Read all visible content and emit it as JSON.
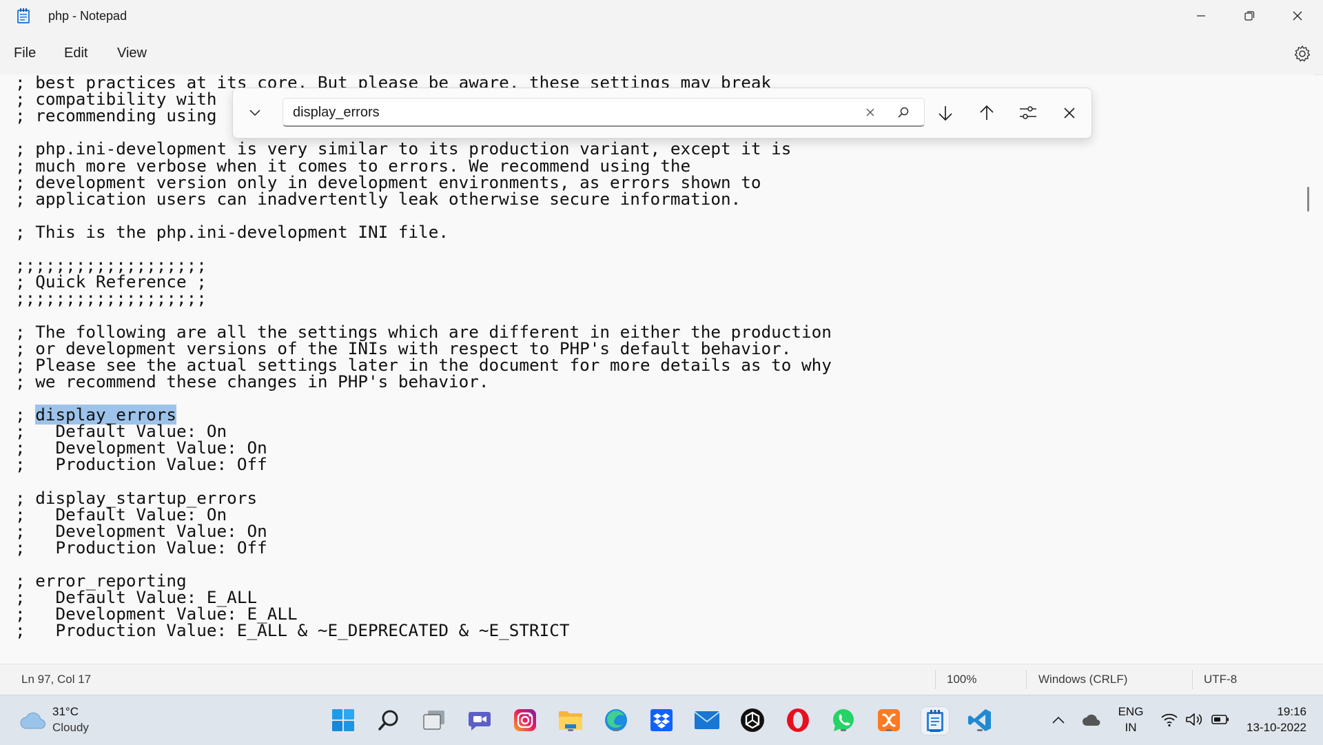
{
  "window": {
    "title": "php - Notepad"
  },
  "menu": {
    "file": "File",
    "edit": "Edit",
    "view": "View"
  },
  "editor": {
    "lines": [
      "; best practices at its core. But please be aware, these settings may break",
      "; compatibility with",
      "; recommending using",
      "",
      "; php.ini-development is very similar to its production variant, except it is",
      "; much more verbose when it comes to errors. We recommend using the",
      "; development version only in development environments, as errors shown to",
      "; application users can inadvertently leak otherwise secure information.",
      "",
      "; This is the php.ini-development INI file.",
      "",
      ";;;;;;;;;;;;;;;;;;;",
      "; Quick Reference ;",
      ";;;;;;;;;;;;;;;;;;;",
      "",
      "; The following are all the settings which are different in either the production",
      "; or development versions of the INIs with respect to PHP's default behavior.",
      "; Please see the actual settings later in the document for more details as to why",
      "; we recommend these changes in PHP's behavior.",
      "",
      "; display_errors",
      ";   Default Value: On",
      ";   Development Value: On",
      ";   Production Value: Off",
      "",
      "; display_startup_errors",
      ";   Default Value: On",
      ";   Development Value: On",
      ";   Production Value: Off",
      "",
      "; error_reporting",
      ";   Default Value: E_ALL",
      ";   Development Value: E_ALL",
      ";   Production Value: E_ALL & ~E_DEPRECATED & ~E_STRICT"
    ],
    "highlight": {
      "prefix": "; ",
      "match": "display_errors"
    }
  },
  "find": {
    "query": "display_errors"
  },
  "status": {
    "position": "Ln 97, Col 17",
    "zoom": "100%",
    "line_ending": "Windows (CRLF)",
    "encoding": "UTF-8"
  },
  "taskbar": {
    "weather_temp": "31°C",
    "weather_desc": "Cloudy",
    "lang_top": "ENG",
    "lang_bottom": "IN",
    "time": "19:16",
    "date": "13-10-2022",
    "apps": [
      "start-icon",
      "search-icon",
      "task-view-icon",
      "teams-chat-icon",
      "instagram-icon",
      "file-explorer-icon",
      "edge-icon",
      "dropbox-icon",
      "mail-icon",
      "chatgpt-icon",
      "opera-icon",
      "whatsapp-icon",
      "xampp-icon",
      "notepad-icon",
      "vscode-icon"
    ]
  },
  "colors": {
    "accent": "#0067c0",
    "highlight": "#9dc3ea"
  }
}
